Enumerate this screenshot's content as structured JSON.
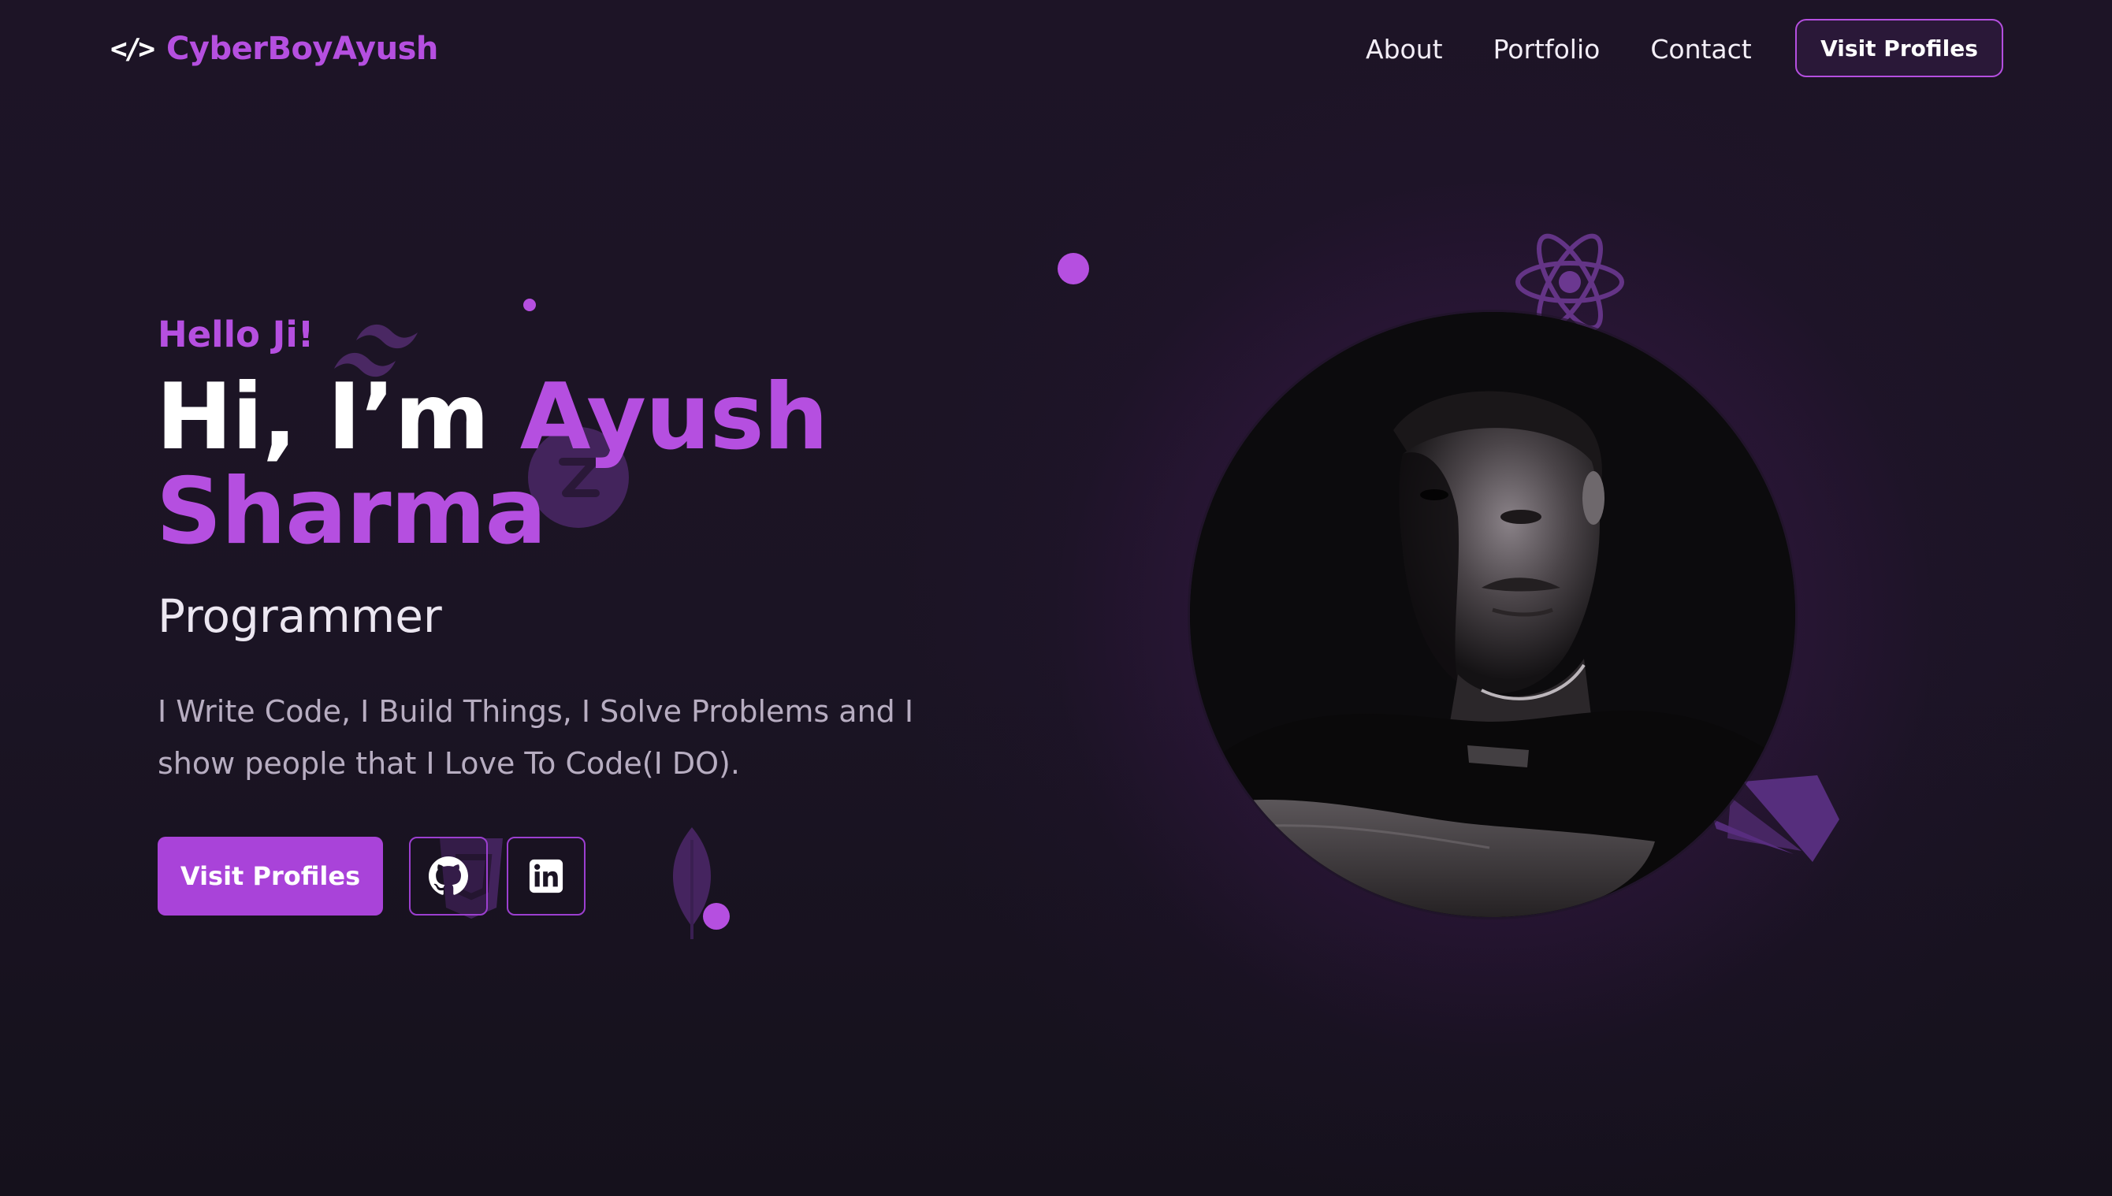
{
  "nav": {
    "logo_icon": "</>",
    "logo_text": "CyberBoyAyush",
    "links": [
      "About",
      "Portfolio",
      "Contact"
    ],
    "cta_label": "Visit Profiles"
  },
  "hero": {
    "greeting": "Hello Ji!",
    "title_prefix": "Hi, I’m ",
    "title_name": "Ayush Sharma",
    "role": "Programmer",
    "bio": "I Write Code, I Build Things, I Solve Problems and I show people that I Love To Code(I DO).",
    "primary_button": "Visit Profiles",
    "social": [
      "github-icon",
      "linkedin-icon"
    ]
  },
  "colors": {
    "accent": "#b54fe0",
    "background": "#1b1424",
    "button": "#a943d9"
  },
  "decorative_icons": [
    "tailwind-icon",
    "react-icon",
    "zustand-icon",
    "css-icon",
    "mongodb-leaf-icon",
    "prisma-icon"
  ]
}
